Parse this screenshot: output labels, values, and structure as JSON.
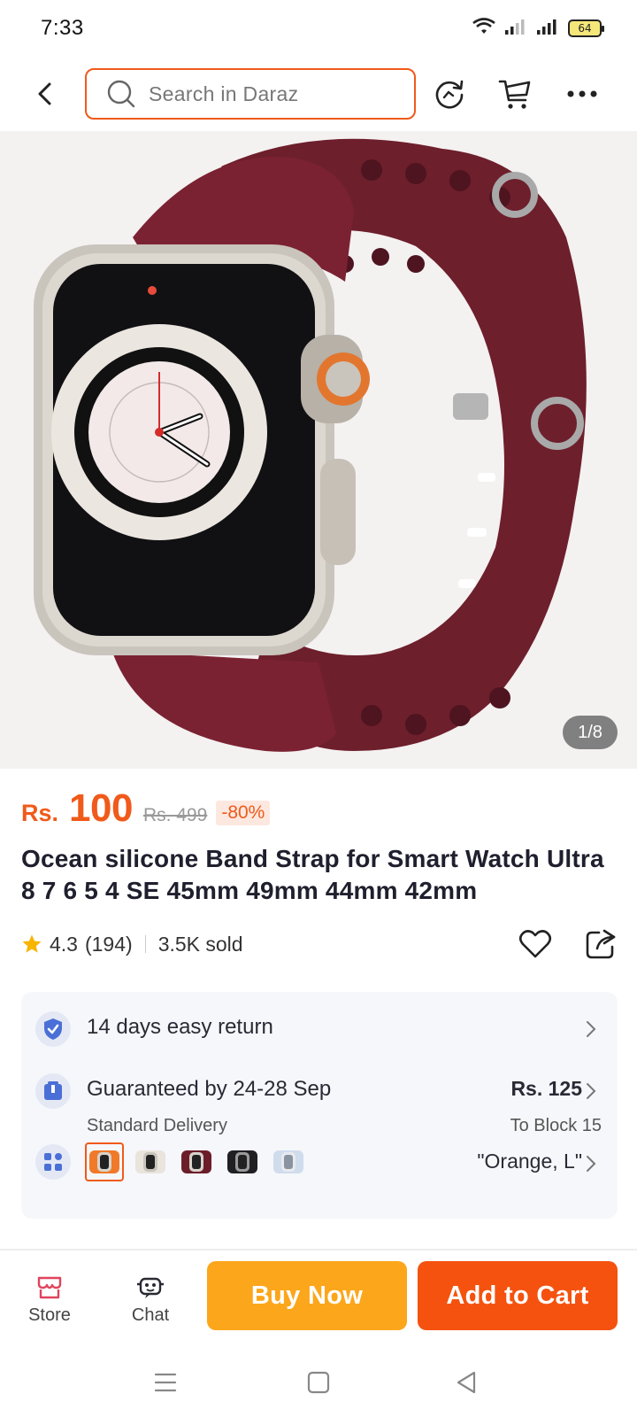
{
  "status_bar": {
    "time": "7:33",
    "battery": "64"
  },
  "search": {
    "placeholder": "Search in Daraz"
  },
  "product": {
    "image_counter": "1/8",
    "currency": "Rs.",
    "price": "100",
    "old_price": "Rs. 499",
    "discount": "-80%",
    "title": "Ocean silicone Band Strap for Smart Watch Ultra 8 7 6 5 4 SE 45mm 49mm 44mm 42mm",
    "rating": "4.3",
    "reviews": "(194)",
    "sold": "3.5K sold"
  },
  "info": {
    "returns": "14 days easy return",
    "delivery_title": "Guaranteed by 24-28 Sep",
    "delivery_type": "Standard Delivery",
    "delivery_price": "Rs. 125",
    "delivery_location": "To Block 15",
    "variant_selected": "\"Orange, L\""
  },
  "swatches": [
    {
      "name": "orange",
      "color": "#f07a2a",
      "selected": true
    },
    {
      "name": "starlight",
      "color": "#e9e4dc",
      "selected": false
    },
    {
      "name": "wine",
      "color": "#6b1e2a",
      "selected": false
    },
    {
      "name": "black",
      "color": "#1f1f24",
      "selected": false
    },
    {
      "name": "light-blue",
      "color": "#cfdcec",
      "selected": false
    }
  ],
  "bottom_bar": {
    "store": "Store",
    "chat": "Chat",
    "buy_now": "Buy Now",
    "add_to_cart": "Add to Cart"
  },
  "colors": {
    "accent": "#f05a1a",
    "buy": "#fca61b",
    "cart": "#f5520f",
    "band": "#6e1f2c"
  }
}
